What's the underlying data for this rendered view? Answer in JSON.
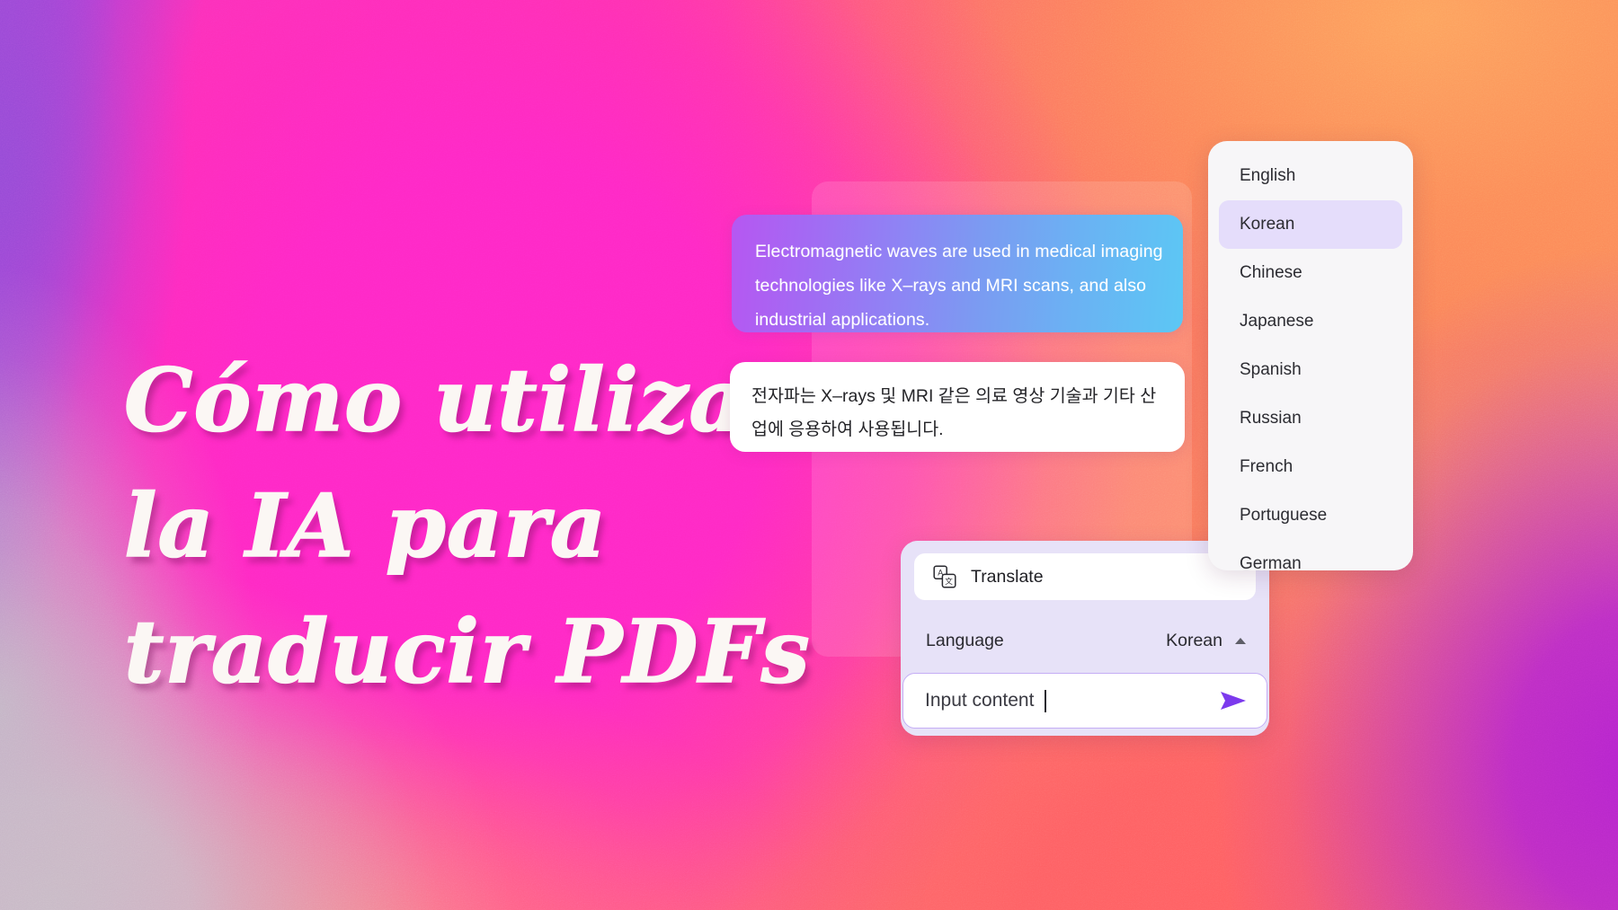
{
  "headline": {
    "lines": [
      "Cómo utilizar",
      "la IA para",
      "traducir PDFs"
    ]
  },
  "conversation": {
    "source_bubble": {
      "name": "source-text-bubble",
      "lines": [
        "Electromagnetic waves are used in medical imaging",
        "technologies like X–rays and MRI scans, and also",
        "industrial applications."
      ]
    },
    "target_bubble": {
      "name": "translated-text-bubble",
      "lines": [
        "전자파는 X–rays 및 MRI 같은 의료 영상 기술과 기타 산",
        "업에 응용하여 사용됩니다."
      ]
    }
  },
  "language_dropdown": {
    "selected": "Korean",
    "options": [
      "English",
      "Korean",
      "Chinese",
      "Japanese",
      "Spanish",
      "Russian",
      "French",
      "Portuguese",
      "German"
    ]
  },
  "translate_card": {
    "title": "Translate",
    "title_icon": "translate-icon",
    "language_label": "Language",
    "language_value": "Korean",
    "chevron_icon": "chevron-up-icon",
    "input_placeholder": "Input content",
    "send_icon": "send-icon"
  },
  "colors": {
    "accent_purple": "#7C3AED",
    "selected_option_bg": "#E5DDFB",
    "card_bg": "#E7E2F8",
    "dropdown_bg": "#F7F6F8",
    "bubble_gradient_start": "#B657F2",
    "bubble_gradient_end": "#5CC7F4",
    "headline_color": "#FBF7F4",
    "background_magenta": "#FF2EC4",
    "background_orange": "#FDA35E",
    "background_purple": "#9B4BD8",
    "background_coral": "#FF5E63"
  }
}
